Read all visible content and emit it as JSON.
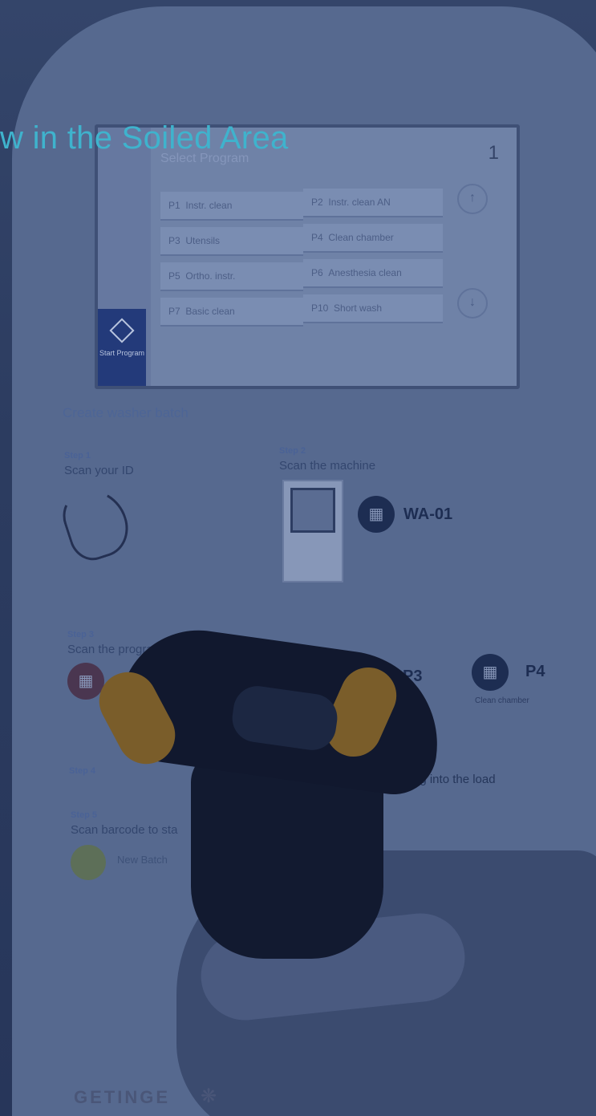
{
  "headline": "w in the Soiled Area",
  "screen": {
    "header": "Select Program",
    "counter": "1",
    "programs": [
      {
        "code": "P1",
        "name": "Instr. clean"
      },
      {
        "code": "P2",
        "name": "Instr. clean AN"
      },
      {
        "code": "P3",
        "name": "Utensils"
      },
      {
        "code": "P4",
        "name": "Clean chamber"
      },
      {
        "code": "P5",
        "name": "Ortho. instr."
      },
      {
        "code": "P6",
        "name": "Anesthesia clean"
      },
      {
        "code": "P7",
        "name": "Basic clean"
      },
      {
        "code": "P10",
        "name": "Short wash"
      }
    ],
    "start_button": "Start Program"
  },
  "poster": {
    "title": "Create washer batch",
    "step1": {
      "label": "Step 1",
      "text": "Scan your ID"
    },
    "step2": {
      "label": "Step 2",
      "text": "Scan the machine",
      "code": "WA-01"
    },
    "step3": {
      "label": "Step 3",
      "text": "Scan the program",
      "codes": [
        {
          "label": "P3",
          "sub": ""
        },
        {
          "label": "P4",
          "sub": "Clean chamber"
        }
      ]
    },
    "step4": {
      "label": "Step 4",
      "text_end": "ng into the load"
    },
    "step5": {
      "label": "Step 5",
      "text": "Scan barcode to sta",
      "button": "New Batch"
    }
  },
  "logo": "GETINGE",
  "icons": {
    "qr": "qr-code-icon",
    "start": "start-diamond-icon",
    "logo_mark": "getinge-star-icon"
  }
}
